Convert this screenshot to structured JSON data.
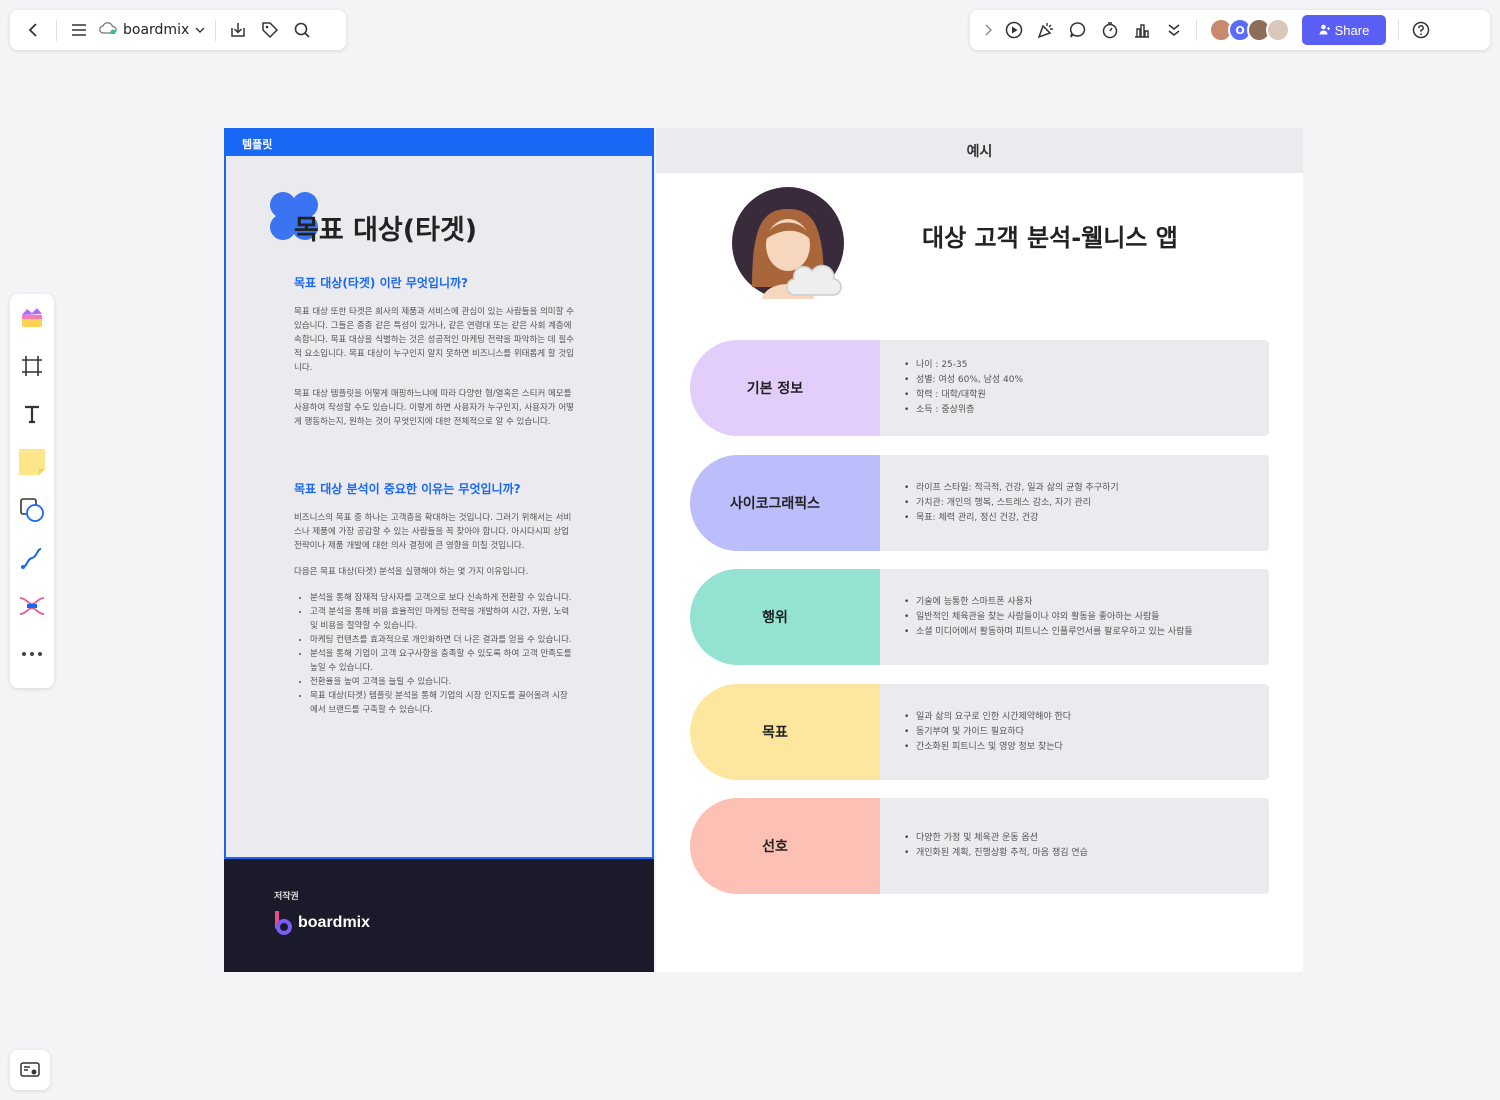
{
  "top_toolbar": {
    "app_name": "boardmix",
    "share_label": "Share",
    "avatar_letter": "O"
  },
  "template": {
    "tag": "템플릿",
    "title": "목표 대상(타겟)",
    "section1_heading": "목표 대상(타겟) 이란 무엇입니까?",
    "section1_p1": "목표 대상 또한 타겟은 회사의 제품과 서비스에 관심이 있는 사람들을 의미할 수 있습니다. 그들은 종종 같은 특성이 있거나, 같은 연령대 또는 같은 사회 계층에 속합니다. 목표 대상을 식별하는 것은 성공적인 마케팅 전략을 파악하는 데 필수적 요소입니다. 목표 대상이 누구인지 알지 못하면 비즈니스를 위태롭게 할 것입니다.",
    "section1_p2": "목표 대상 템플릿을 어떻게 매핑하느냐에 따라 다양한 형/열혹은 스티커 메모를 사용하여 작성할 수도 있습니다. 이렇게 하면 사용자가 누구인지, 사용자가 어떻게 행동하는지, 원하는 것이 무엇인지에 대한 전체적으로 알 수 있습니다.",
    "section2_heading": "목표 대상 분석이 중요한 이유는 무엇입니까?",
    "section2_p1": "비즈니스의 목표 중 하나는 고객층을 확대하는 것입니다. 그러기 위해서는 서비스나 제품에 가장 공감할 수 있는 사람들을 꼭 찾아야 합니다. 아시다시피 상업 전략이나 제품 개발에 대한 의사 결정에 큰 영향을 미칠 것입니다.",
    "section2_p2": "다음은 목표 대상(타겟) 분석을 실행해야 하는 몇 가지 이유입니다.",
    "section2_list": [
      "분석을 통해 잠재적 당사자를 고객으로 보다 신속하게 전환할 수 있습니다.",
      "고객 분석을 통해 비용 효율적인 마케팅 전략을 개발하여 시간, 자원, 노력 및 비용을 절약할 수 있습니다.",
      "마케팅 컨텐츠를 효과적으로 개인화하면 더 나은 결과를 얻을 수 있습니다.",
      "분석을 통해 기업이 고객 요구사항을 충족할 수 있도록 하여 고객 만족도를 높일 수 있습니다.",
      "전환율을 높여 고객을 늘릴 수 있습니다.",
      "목표 대상(타겟) 템플릿 분석을 통해 기업의 시장 인지도를 끌어올려 시장에서 브랜드를 구축할 수 있습니다."
    ],
    "footer_label": "저작권",
    "footer_brand": "boardmix"
  },
  "example": {
    "tag": "예시",
    "title": "대상 고객 분석-웰니스 앱",
    "rows": [
      {
        "label": "기본 정보",
        "color": "#e3cdfb",
        "items": [
          "나이 : 25-35",
          "성별: 여성 60%, 남성 40%",
          "학력 : 대학/대학원",
          "소득 : 중상위층"
        ]
      },
      {
        "label": "사이코그래픽스",
        "color": "#bcbdfb",
        "items": [
          "라이프 스타일: 적극적, 건강, 일과 삶의 균형 추구하기",
          "가치관: 개인의 행복, 스트레스 감소, 자기 관리",
          "목표: 체력 관리, 정신 건강, 건강"
        ]
      },
      {
        "label": "행위",
        "color": "#94e3d2",
        "items": [
          "기술에 능통한 스마트폰 사용자",
          "일반적인 체육관을 찾는 사람들이나 야외 활동을 좋아하는 사람들",
          "소셜 미디어에서 활동하며 피트니스 인플루언서를 팔로우하고 있는 사람들"
        ]
      },
      {
        "label": "목표",
        "color": "#fde79f",
        "items": [
          "일과 삶의 요구로 인한 시간제약해야 한다",
          "동기부여 및 가이드 필요하다",
          "간소화된 피트니스 및 영양 정보 찾는다"
        ]
      },
      {
        "label": "선호",
        "color": "#fdc0b5",
        "items": [
          "다양한 가정 및 체육관 운동 옵션",
          "개인화된 계획, 진행상황 추적, 마음 챙김 연습"
        ]
      }
    ]
  }
}
